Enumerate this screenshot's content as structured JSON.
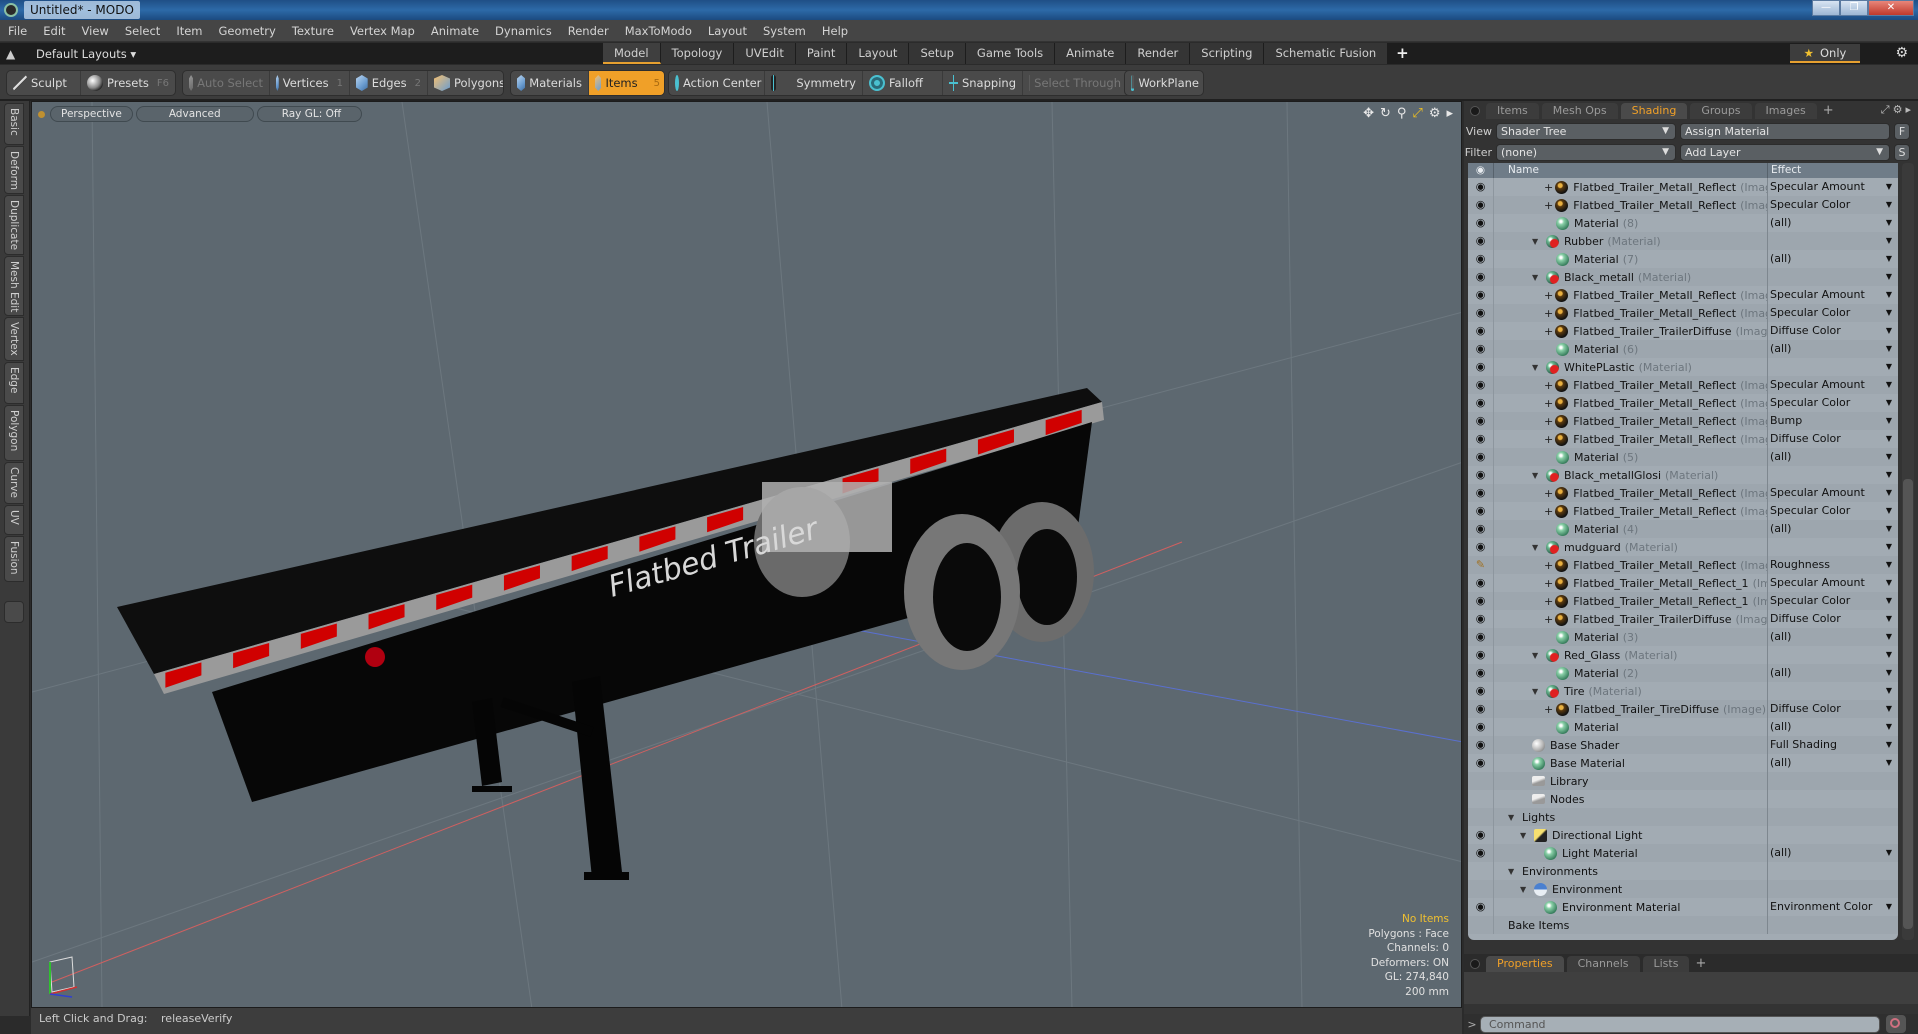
{
  "window": {
    "title": "Untitled* - MODO",
    "controls": [
      "minimize",
      "restore",
      "close"
    ]
  },
  "menubar": {
    "items": [
      "File",
      "Edit",
      "View",
      "Select",
      "Item",
      "Geometry",
      "Texture",
      "Vertex Map",
      "Animate",
      "Dynamics",
      "Render",
      "MaxToModo",
      "Layout",
      "System",
      "Help"
    ]
  },
  "layoutbar": {
    "dropdown": "Default Layouts",
    "tabs": [
      "Model",
      "Topology",
      "UVEdit",
      "Paint",
      "Layout",
      "Setup",
      "Game Tools",
      "Animate",
      "Render",
      "Scripting",
      "Schematic Fusion"
    ],
    "active_tab": "Model",
    "add_label": "+",
    "only_label": "Only"
  },
  "toolbar": {
    "sculpt": "Sculpt",
    "presets": "Presets",
    "presets_key": "F6",
    "auto_select": "Auto Select",
    "vertices": "Vertices",
    "vertices_key": "1",
    "edges": "Edges",
    "edges_key": "2",
    "polygons": "Polygons",
    "materials": "Materials",
    "items": "Items",
    "items_key": "5",
    "action_center": "Action Center",
    "symmetry": "Symmetry",
    "falloff": "Falloff",
    "snapping": "Snapping",
    "select_through": "Select Through",
    "workplane": "WorkPlane"
  },
  "left_tabs": [
    "Basic",
    "Deform",
    "Duplicate",
    "Mesh Edit",
    "Vertex",
    "Edge",
    "Polygon",
    "Curve",
    "UV",
    "Fusion"
  ],
  "viewport": {
    "view_mode": "Perspective",
    "shading": "Advanced",
    "raygl": "Ray GL: Off",
    "model_label": "Flatbed Trailer",
    "info": {
      "selection": "No Items",
      "polygons": "Polygons : Face",
      "channels": "Channels: 0",
      "deformers": "Deformers: ON",
      "gl": "GL: 274,840",
      "scale": "200 mm"
    },
    "colors": {
      "background": "#5d6870",
      "reflector_red": "#d00000",
      "rail_silver": "#9a9a9a",
      "deck_black": "#0c0c0c",
      "info_highlight": "#f0c030"
    }
  },
  "statusbar": {
    "label": "Left Click and Drag:",
    "value": "releaseVerify"
  },
  "panel": {
    "tabs": [
      "Items",
      "Mesh Ops",
      "Shading",
      "Groups",
      "Images"
    ],
    "active_tab": "Shading",
    "view_label": "View",
    "view_value": "Shader Tree",
    "assign_material": "Assign Material",
    "f_button": "F",
    "filter_label": "Filter",
    "filter_value": "(none)",
    "add_layer": "Add Layer",
    "s_button": "S",
    "columns": {
      "name": "Name",
      "effect": "Effect"
    },
    "rows": [
      {
        "depth": 3,
        "kind": "image",
        "expander": "plus",
        "name": "Flatbed_Trailer_Metall_Reflect",
        "type": "(Imag…",
        "effect": "Specular Amount",
        "eye": "eye",
        "dd": true
      },
      {
        "depth": 3,
        "kind": "image",
        "expander": "plus",
        "name": "Flatbed_Trailer_Metall_Reflect",
        "type": "(Imag…",
        "effect": "Specular Color",
        "eye": "eye",
        "dd": true
      },
      {
        "depth": 3,
        "kind": "material",
        "expander": "",
        "name": "Material",
        "type": "(8)",
        "effect": "(all)",
        "eye": "eye",
        "dd": true
      },
      {
        "depth": 2,
        "kind": "matgroup",
        "expander": "tri",
        "name": "Rubber",
        "type": "(Material)",
        "effect": "",
        "eye": "eye",
        "dd": true
      },
      {
        "depth": 3,
        "kind": "material",
        "expander": "",
        "name": "Material",
        "type": "(7)",
        "effect": "(all)",
        "eye": "eye",
        "dd": true
      },
      {
        "depth": 2,
        "kind": "matgroup",
        "expander": "tri",
        "name": "Black_metall",
        "type": "(Material)",
        "effect": "",
        "eye": "eye",
        "dd": true
      },
      {
        "depth": 3,
        "kind": "image",
        "expander": "plus",
        "name": "Flatbed_Trailer_Metall_Reflect",
        "type": "(Imag…",
        "effect": "Specular Amount",
        "eye": "eye",
        "dd": true
      },
      {
        "depth": 3,
        "kind": "image",
        "expander": "plus",
        "name": "Flatbed_Trailer_Metall_Reflect",
        "type": "(Imag…",
        "effect": "Specular Color",
        "eye": "eye",
        "dd": true
      },
      {
        "depth": 3,
        "kind": "image",
        "expander": "plus",
        "name": "Flatbed_Trailer_TrailerDiffuse",
        "type": "(Image…",
        "effect": "Diffuse Color",
        "eye": "eye",
        "dd": true
      },
      {
        "depth": 3,
        "kind": "material",
        "expander": "",
        "name": "Material",
        "type": "(6)",
        "effect": "(all)",
        "eye": "eye",
        "dd": true
      },
      {
        "depth": 2,
        "kind": "matgroup",
        "expander": "tri",
        "name": "WhitePLastic",
        "type": "(Material)",
        "effect": "",
        "eye": "eye",
        "dd": true
      },
      {
        "depth": 3,
        "kind": "image",
        "expander": "plus",
        "name": "Flatbed_Trailer_Metall_Reflect",
        "type": "(Imag…",
        "effect": "Specular Amount",
        "eye": "eye",
        "dd": true
      },
      {
        "depth": 3,
        "kind": "image",
        "expander": "plus",
        "name": "Flatbed_Trailer_Metall_Reflect",
        "type": "(Imag…",
        "effect": "Specular Color",
        "eye": "eye",
        "dd": true
      },
      {
        "depth": 3,
        "kind": "image",
        "expander": "plus",
        "name": "Flatbed_Trailer_Metall_Reflect",
        "type": "(Imag…",
        "effect": "Bump",
        "eye": "eye",
        "dd": true
      },
      {
        "depth": 3,
        "kind": "image",
        "expander": "plus",
        "name": "Flatbed_Trailer_Metall_Reflect",
        "type": "(Image)",
        "effect": "Diffuse Color",
        "eye": "eye",
        "dd": true
      },
      {
        "depth": 3,
        "kind": "material",
        "expander": "",
        "name": "Material",
        "type": "(5)",
        "effect": "(all)",
        "eye": "eye",
        "dd": true
      },
      {
        "depth": 2,
        "kind": "matgroup",
        "expander": "tri",
        "name": "Black_metallGlosi",
        "type": "(Material)",
        "effect": "",
        "eye": "eye",
        "dd": true
      },
      {
        "depth": 3,
        "kind": "image",
        "expander": "plus",
        "name": "Flatbed_Trailer_Metall_Reflect",
        "type": "(Imag…",
        "effect": "Specular Amount",
        "eye": "eye",
        "dd": true
      },
      {
        "depth": 3,
        "kind": "image",
        "expander": "plus",
        "name": "Flatbed_Trailer_Metall_Reflect",
        "type": "(Imag…",
        "effect": "Specular Color",
        "eye": "eye",
        "dd": true
      },
      {
        "depth": 3,
        "kind": "material",
        "expander": "",
        "name": "Material",
        "type": "(4)",
        "effect": "(all)",
        "eye": "eye",
        "dd": true
      },
      {
        "depth": 2,
        "kind": "matgroup",
        "expander": "tri",
        "name": "mudguard",
        "type": "(Material)",
        "effect": "",
        "eye": "eye",
        "dd": true
      },
      {
        "depth": 3,
        "kind": "image",
        "expander": "plus",
        "name": "Flatbed_Trailer_Metall_Reflect",
        "type": "(Imag…",
        "effect": "Roughness",
        "eye": "brush",
        "dd": true
      },
      {
        "depth": 3,
        "kind": "image",
        "expander": "plus",
        "name": "Flatbed_Trailer_Metall_Reflect_1",
        "type": "(Im…",
        "effect": "Specular Amount",
        "eye": "eye",
        "dd": true
      },
      {
        "depth": 3,
        "kind": "image",
        "expander": "plus",
        "name": "Flatbed_Trailer_Metall_Reflect_1",
        "type": "(Im…",
        "effect": "Specular Color",
        "eye": "eye",
        "dd": true
      },
      {
        "depth": 3,
        "kind": "image",
        "expander": "plus",
        "name": "Flatbed_Trailer_TrailerDiffuse",
        "type": "(Image)",
        "effect": "Diffuse Color",
        "eye": "eye",
        "dd": true
      },
      {
        "depth": 3,
        "kind": "material",
        "expander": "",
        "name": "Material",
        "type": "(3)",
        "effect": "(all)",
        "eye": "eye",
        "dd": true
      },
      {
        "depth": 2,
        "kind": "matgroup",
        "expander": "tri",
        "name": "Red_Glass",
        "type": "(Material)",
        "effect": "",
        "eye": "eye",
        "dd": true
      },
      {
        "depth": 3,
        "kind": "material",
        "expander": "",
        "name": "Material",
        "type": "(2)",
        "effect": "(all)",
        "eye": "eye",
        "dd": true
      },
      {
        "depth": 2,
        "kind": "matgroup",
        "expander": "tri",
        "name": "Tire",
        "type": "(Material)",
        "effect": "",
        "eye": "eye",
        "dd": true
      },
      {
        "depth": 3,
        "kind": "image",
        "expander": "plus",
        "name": "Flatbed_Trailer_TireDiffuse",
        "type": "(Image)",
        "effect": "Diffuse Color",
        "eye": "eye",
        "dd": true
      },
      {
        "depth": 3,
        "kind": "material",
        "expander": "",
        "name": "Material",
        "type": "",
        "effect": "(all)",
        "eye": "eye",
        "dd": true
      },
      {
        "depth": 1,
        "kind": "shader",
        "expander": "",
        "name": "Base Shader",
        "type": "",
        "effect": "Full Shading",
        "eye": "eye",
        "dd": true
      },
      {
        "depth": 1,
        "kind": "material",
        "expander": "",
        "name": "Base Material",
        "type": "",
        "effect": "(all)",
        "eye": "eye",
        "dd": true
      },
      {
        "depth": 1,
        "kind": "folder",
        "expander": "",
        "name": "Library",
        "type": "",
        "effect": "",
        "eye": "",
        "dd": false
      },
      {
        "depth": 1,
        "kind": "folder",
        "expander": "",
        "name": "Nodes",
        "type": "",
        "effect": "",
        "eye": "",
        "dd": false
      },
      {
        "depth": 0,
        "kind": "none",
        "expander": "tri",
        "name": "Lights",
        "type": "",
        "effect": "",
        "eye": "",
        "dd": false
      },
      {
        "depth": 1,
        "kind": "light",
        "expander": "tri",
        "name": "Directional Light",
        "type": "",
        "effect": "",
        "eye": "eye",
        "dd": false
      },
      {
        "depth": 2,
        "kind": "material",
        "expander": "",
        "name": "Light Material",
        "type": "",
        "effect": "(all)",
        "eye": "eye",
        "dd": true
      },
      {
        "depth": 0,
        "kind": "none",
        "expander": "tri",
        "name": "Environments",
        "type": "",
        "effect": "",
        "eye": "",
        "dd": false
      },
      {
        "depth": 1,
        "kind": "env",
        "expander": "tri",
        "name": "Environment",
        "type": "",
        "effect": "",
        "eye": "",
        "dd": false
      },
      {
        "depth": 2,
        "kind": "material",
        "expander": "",
        "name": "Environment Material",
        "type": "",
        "effect": "Environment Color",
        "eye": "eye",
        "dd": true
      },
      {
        "depth": 0,
        "kind": "none",
        "expander": "",
        "name": "Bake Items",
        "type": "",
        "effect": "",
        "eye": "",
        "dd": false
      }
    ],
    "bottom_tabs": [
      "Properties",
      "Channels",
      "Lists"
    ],
    "bottom_active": "Properties",
    "command_placeholder": "Command",
    "command_prompt": ">"
  },
  "accent_color": "#f0a028"
}
